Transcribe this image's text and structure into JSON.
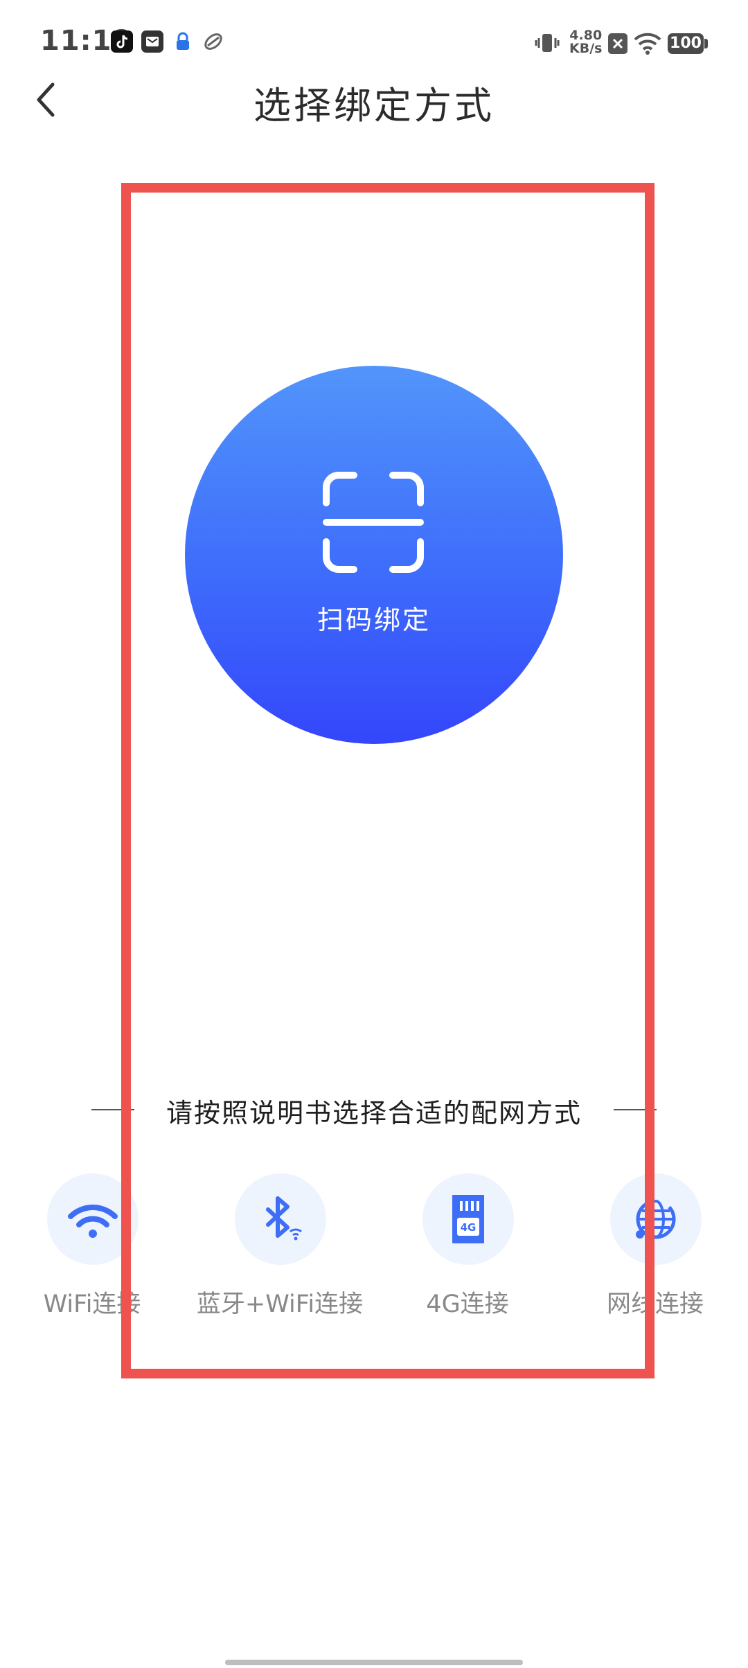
{
  "status_bar": {
    "time": "11:18",
    "net_speed_value": "4.80",
    "net_speed_unit": "KB/s",
    "battery": "100"
  },
  "header": {
    "title": "选择绑定方式"
  },
  "scan": {
    "label": "扫码绑定"
  },
  "instruction": "请按照说明书选择合适的配网方式",
  "options": [
    {
      "label": "WiFi连接",
      "icon": "wifi-icon"
    },
    {
      "label": "蓝牙+WiFi连接",
      "icon": "bluetooth-wifi-icon"
    },
    {
      "label": "4G连接",
      "icon": "sim-4g-icon"
    },
    {
      "label": "网线连接",
      "icon": "ethernet-globe-icon"
    }
  ],
  "colors": {
    "accent": "#3e6cfb",
    "highlight": "#ef5350",
    "option_bg": "#eef4fe"
  }
}
